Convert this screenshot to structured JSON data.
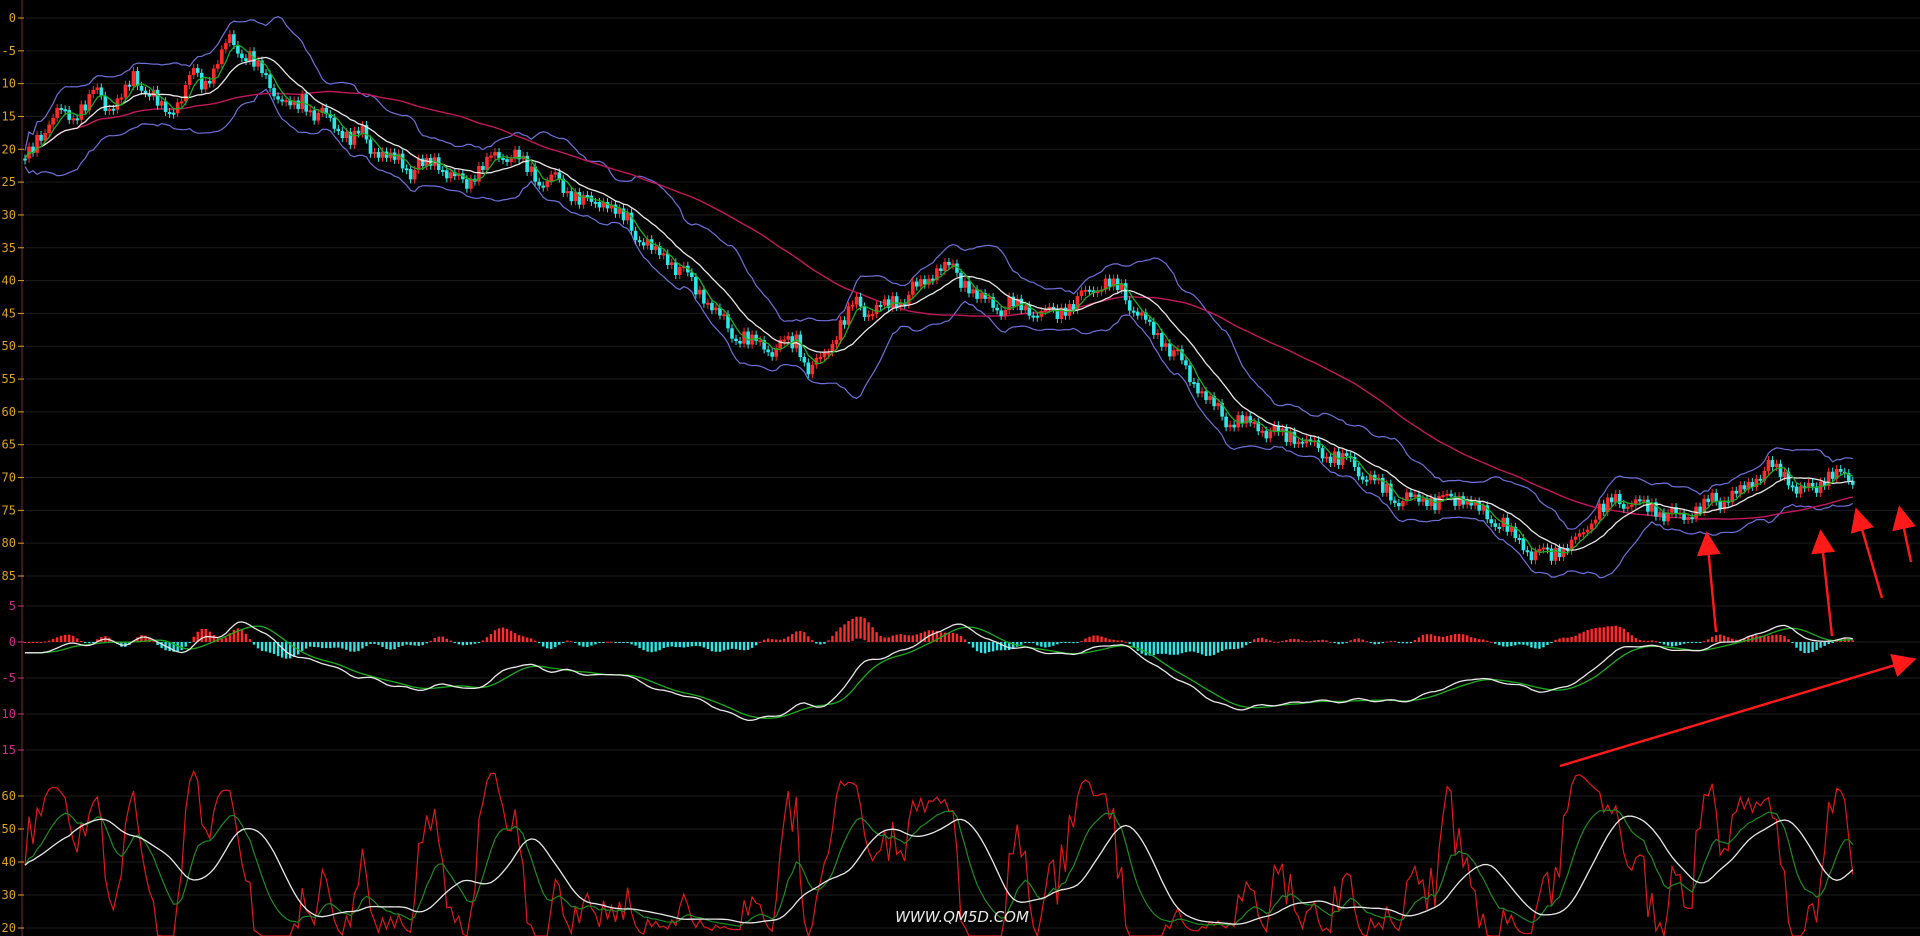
{
  "watermark": "WWW.QM5D.COM",
  "colors": {
    "background": "#000000",
    "up_candle": "#ff2b2b",
    "down_candle": "#2ee6e6",
    "ma_green": "#1faa1f",
    "ma_white": "#e8e8e8",
    "ma_long": "#c0185a",
    "bands": "#6f6fd8",
    "grid": "#1b1b1b",
    "arrow": "#ff1a1a",
    "axis_tick_price": "#e0a020",
    "axis_tick_macd": "#cc2a8c",
    "kdj_k": "#e8e8e8",
    "kdj_d": "#1e8a1e",
    "kdj_j": "#dd1a1a"
  },
  "chart_data": [
    {
      "type": "line",
      "panel": "price",
      "y_ticks": [
        "0",
        "-5",
        "-10",
        "-15",
        "-20",
        "-25",
        "-30",
        "-35",
        "-40",
        "-45",
        "-50",
        "-55",
        "-60",
        "-65",
        "-70",
        "-75",
        "-80",
        "-85"
      ],
      "x": [
        0,
        10,
        20,
        30,
        40,
        50,
        60,
        70,
        80,
        90,
        100,
        110,
        120,
        130,
        140,
        150,
        160,
        170,
        180,
        190,
        200,
        210,
        220,
        230,
        240,
        250,
        260,
        270,
        280,
        290,
        300,
        310,
        320,
        330,
        340,
        350,
        360,
        370,
        380,
        390,
        400,
        410,
        420,
        430,
        440,
        450,
        460,
        470,
        480,
        490,
        500,
        510,
        520,
        530,
        540,
        550,
        560,
        570,
        580,
        590,
        600,
        610,
        620,
        630,
        640,
        650,
        660,
        670,
        680,
        690,
        700,
        710,
        720,
        730,
        740,
        750,
        760,
        770,
        780,
        790,
        800,
        810,
        820,
        830,
        840,
        850,
        860,
        870,
        880,
        890,
        900,
        910,
        920,
        930,
        940,
        950,
        960,
        970,
        980,
        990,
        1000,
        1010,
        1020,
        1030,
        1040,
        1050,
        1060,
        1070,
        1080,
        1090,
        1100,
        1110,
        1120,
        1130,
        1140,
        1150,
        1160,
        1170,
        1180,
        1190,
        1200,
        1210,
        1220,
        1230,
        1240,
        1250,
        1260,
        1270,
        1280,
        1290,
        1300,
        1310,
        1320,
        1330,
        1340,
        1350,
        1360,
        1370,
        1380,
        1390,
        1400,
        1410,
        1420,
        1430,
        1440,
        1450,
        1460,
        1470,
        1480,
        1490,
        1500,
        1510,
        1520,
        1530,
        1540,
        1550,
        1560
      ],
      "series": [
        {
          "values": [
            -22,
            -19,
            -15,
            -14,
            -15,
            -13,
            -12,
            -14,
            -12,
            -9,
            -10,
            -13,
            -15,
            -12,
            -9,
            -10,
            -6,
            -3,
            -5,
            -7,
            -10,
            -12,
            -14,
            -12,
            -14,
            -15,
            -17,
            -19,
            -18,
            -20,
            -21,
            -21,
            -23,
            -23,
            -22,
            -24,
            -25,
            -24,
            -22,
            -21,
            -21,
            -22,
            -24,
            -25,
            -24,
            -26,
            -27,
            -29,
            -28,
            -30,
            -31,
            -33,
            -35,
            -36,
            -38,
            -40,
            -42,
            -44,
            -46,
            -48,
            -49,
            -50,
            -51,
            -50,
            -49,
            -53,
            -52,
            -49,
            -46,
            -44,
            -45,
            -44,
            -43,
            -42,
            -41,
            -40,
            -38,
            -39,
            -40,
            -42,
            -43,
            -44,
            -44,
            -45,
            -45,
            -45,
            -44,
            -43,
            -42,
            -41,
            -41,
            -42,
            -44,
            -46,
            -48,
            -50,
            -53,
            -56,
            -58,
            -60,
            -61,
            -61,
            -62,
            -63,
            -64,
            -64,
            -64,
            -65,
            -66,
            -67,
            -68,
            -70,
            -71,
            -72,
            -73,
            -73,
            -73,
            -74,
            -74,
            -73,
            -74,
            -75,
            -76,
            -78,
            -80,
            -82,
            -82,
            -81,
            -80,
            -79,
            -76,
            -75,
            -74,
            -74,
            -74,
            -74,
            -75,
            -76,
            -76,
            -75,
            -74,
            -73,
            -72,
            -71,
            -69,
            -69,
            -70,
            -72,
            -72,
            -70,
            -69,
            -70,
            -71
          ]
        }
      ]
    },
    {
      "type": "line",
      "panel": "macd",
      "y_ticks": [
        "5",
        "0",
        "-5",
        "-10",
        "-15"
      ],
      "series": []
    },
    {
      "type": "line",
      "panel": "kdj",
      "y_ticks": [
        "60",
        "50",
        "40",
        "30",
        "20"
      ],
      "series": []
    }
  ]
}
